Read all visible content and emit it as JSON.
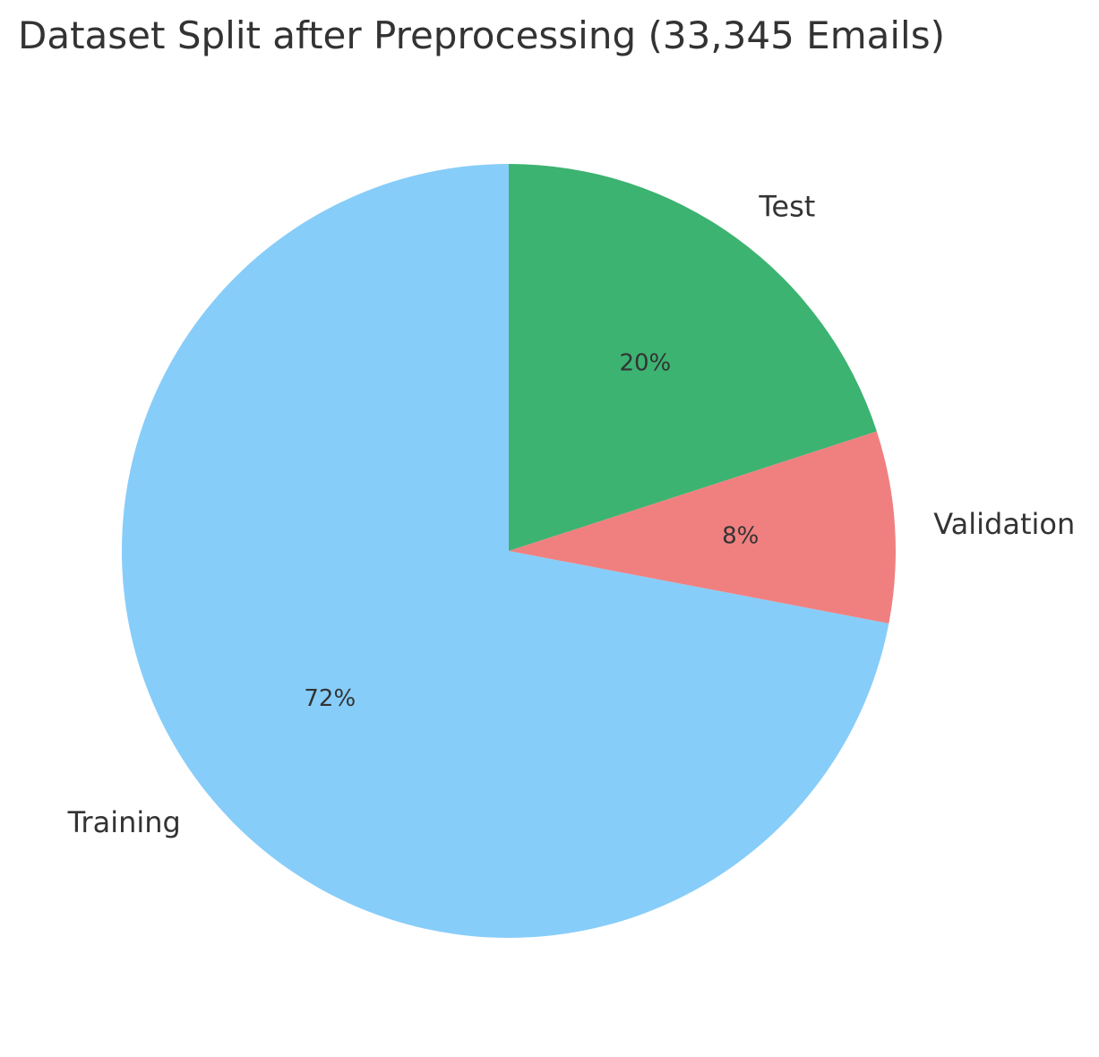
{
  "chart_data": {
    "type": "pie",
    "title": "Dataset Split after Preprocessing (33,345 Emails)",
    "slices": [
      {
        "label": "Training",
        "value": 72,
        "pct_label": "72%",
        "color": "#87CDF9"
      },
      {
        "label": "Validation",
        "value": 8,
        "pct_label": "8%",
        "color": "#F08080"
      },
      {
        "label": "Test",
        "value": 20,
        "pct_label": "20%",
        "color": "#3CB371"
      }
    ],
    "start_angle": "top",
    "direction": "counterclockwise",
    "legend": "none"
  }
}
